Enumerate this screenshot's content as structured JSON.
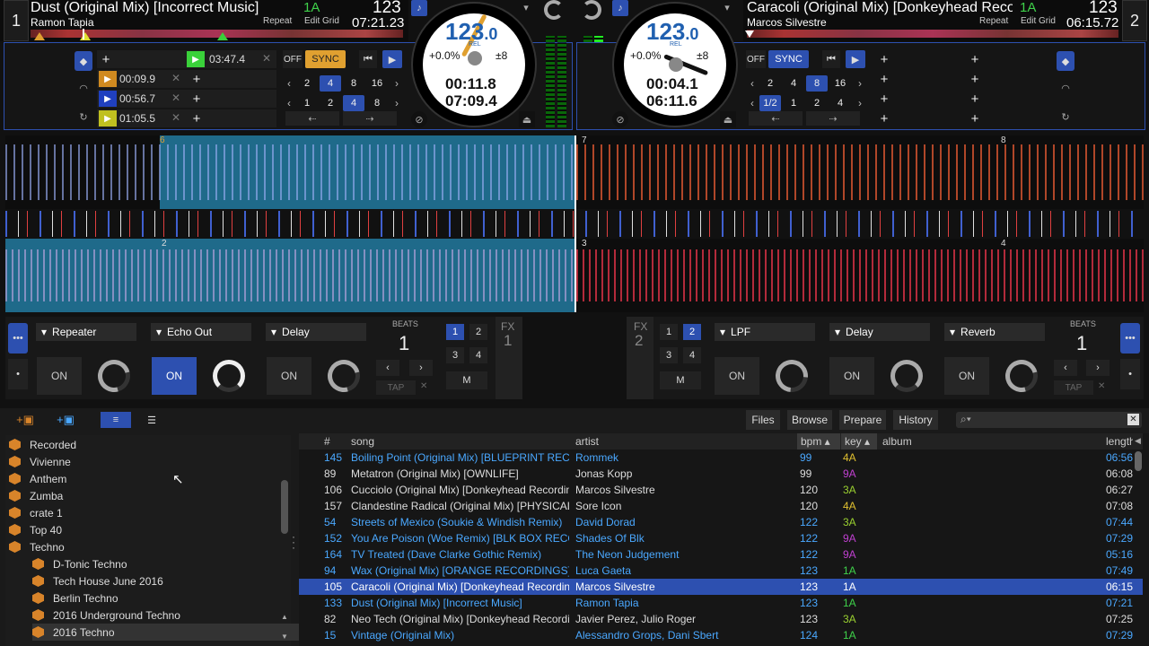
{
  "deck1": {
    "number": "1",
    "title": "Dust (Original Mix) [Incorrect Music]",
    "artist": "Ramon Tapia",
    "key": "1A",
    "bpm": "123",
    "repeat": "Repeat",
    "edit_grid": "Edit Grid",
    "time": "07:21.23",
    "loop_time": "03:47.4",
    "cues": [
      "00:09.9",
      "00:56.7",
      "01:05.5"
    ],
    "sync_off": "OFF",
    "sync": "SYNC",
    "loop_row1": [
      "2",
      "4",
      "8",
      "16"
    ],
    "loop_row2": [
      "1",
      "2",
      "4",
      "8"
    ],
    "loop_row1_selected": "4",
    "loop_row2_selected": "4",
    "jog_bpm": "123",
    "jog_bpm_dec": ".0",
    "jog_rel": "REL",
    "pitch": "+0.0%",
    "range": "±8",
    "elapsed": "00:11.8",
    "remain": "07:09.4"
  },
  "deck2": {
    "number": "2",
    "title": "Caracoli (Original Mix) [Donkeyhead Recordings]",
    "artist": "Marcos Silvestre",
    "key": "1A",
    "bpm": "123",
    "repeat": "Repeat",
    "edit_grid": "Edit Grid",
    "time": "06:15.72",
    "sync_off": "OFF",
    "sync": "SYNC",
    "loop_row1": [
      "2",
      "4",
      "8",
      "16"
    ],
    "loop_row2": [
      "1/2",
      "1",
      "2",
      "4"
    ],
    "loop_row1_selected": "8",
    "loop_row2_selected": "1/2",
    "jog_bpm": "123",
    "jog_bpm_dec": ".0",
    "jog_rel": "REL",
    "pitch": "+0.0%",
    "range": "±8",
    "elapsed": "00:04.1",
    "remain": "06:11.6"
  },
  "waveform_markers": {
    "top_left": "6",
    "top_right_a": "7",
    "top_right_b": "8",
    "bottom_left": "2",
    "bottom_right_a": "3",
    "bottom_right_b": "4"
  },
  "fx1": {
    "label": "FX",
    "num": "1",
    "effects": [
      "Repeater",
      "Echo Out",
      "Delay"
    ],
    "on_label": "ON",
    "beats_label": "BEATS",
    "beats": "1",
    "tap": "TAP",
    "slots": [
      "1",
      "2",
      "3",
      "4"
    ],
    "selected_slot": "1",
    "m": "M"
  },
  "fx2": {
    "label": "FX",
    "num": "2",
    "effects": [
      "LPF",
      "Delay",
      "Reverb"
    ],
    "on_label": "ON",
    "beats_label": "BEATS",
    "beats": "1",
    "tap": "TAP",
    "slots": [
      "1",
      "2",
      "3",
      "4"
    ],
    "selected_slot": "2",
    "m": "M"
  },
  "browser": {
    "tabs": [
      "Files",
      "Browse",
      "Prepare",
      "History"
    ],
    "search_placeholder": "",
    "tree": [
      {
        "label": "Recorded",
        "sub": false
      },
      {
        "label": "Vivienne",
        "sub": false
      },
      {
        "label": "Anthem",
        "sub": false
      },
      {
        "label": "Zumba",
        "sub": false
      },
      {
        "label": "crate 1",
        "sub": false
      },
      {
        "label": "Top 40",
        "sub": false
      },
      {
        "label": "Techno",
        "sub": false
      },
      {
        "label": "D-Tonic Techno",
        "sub": true
      },
      {
        "label": "Tech House June 2016",
        "sub": true
      },
      {
        "label": "Berlin Techno",
        "sub": true
      },
      {
        "label": "2016 Underground Techno",
        "sub": true
      },
      {
        "label": "2016 Techno",
        "sub": true
      }
    ],
    "columns": {
      "num": "#",
      "song": "song",
      "artist": "artist",
      "bpm": "bpm",
      "key": "key",
      "album": "album",
      "length": "length"
    },
    "rows": [
      {
        "num": "145",
        "song": "Boiling Point (Original Mix) [BLUEPRINT RECORDS]",
        "artist": "Rommek",
        "bpm": "99",
        "key": "4A",
        "length": "06:56",
        "hl": true,
        "kc": "#e0c030"
      },
      {
        "num": "89",
        "song": "Metatron (Original Mix) [OWNLIFE]",
        "artist": "Jonas Kopp",
        "bpm": "99",
        "key": "9A",
        "length": "06:08",
        "hl": false,
        "kc": "#c040d0"
      },
      {
        "num": "106",
        "song": "Cucciolo (Original Mix) [Donkeyhead Recordings]",
        "artist": "Marcos Silvestre",
        "bpm": "120",
        "key": "3A",
        "length": "06:27",
        "hl": false,
        "kc": "#9ad030"
      },
      {
        "num": "157",
        "song": "Clandestine Radical (Original Mix) [PHYSICAL]",
        "artist": "Sore Icon",
        "bpm": "120",
        "key": "4A",
        "length": "07:08",
        "hl": false,
        "kc": "#e0c030"
      },
      {
        "num": "54",
        "song": "Streets of Mexico (Soukie & Windish Remix)",
        "artist": "David Dorad",
        "bpm": "122",
        "key": "3A",
        "length": "07:44",
        "hl": true,
        "kc": "#9ad030"
      },
      {
        "num": "152",
        "song": "You Are Poison (Woe Remix) [BLK BOX RECORDS]",
        "artist": "Shades Of Blk",
        "bpm": "122",
        "key": "9A",
        "length": "07:29",
        "hl": true,
        "kc": "#c040d0"
      },
      {
        "num": "164",
        "song": "TV Treated (Dave Clarke Gothic Remix)",
        "artist": "The Neon Judgement",
        "bpm": "122",
        "key": "9A",
        "length": "05:16",
        "hl": true,
        "kc": "#c040d0"
      },
      {
        "num": "94",
        "song": "Wax (Original Mix) [ORANGE RECORDINGS]",
        "artist": "Luca Gaeta",
        "bpm": "123",
        "key": "1A",
        "length": "07:49",
        "hl": true,
        "kc": "#3fd14a"
      },
      {
        "num": "105",
        "song": "Caracoli (Original Mix) [Donkeyhead Recordings]",
        "artist": "Marcos Silvestre",
        "bpm": "123",
        "key": "1A",
        "length": "06:15",
        "hl": false,
        "kc": "#3fd14a",
        "sel": true
      },
      {
        "num": "133",
        "song": "Dust (Original Mix) [Incorrect Music]",
        "artist": "Ramon Tapia",
        "bpm": "123",
        "key": "1A",
        "length": "07:21",
        "hl": true,
        "kc": "#3fd14a"
      },
      {
        "num": "82",
        "song": "Neo Tech (Original Mix) [Donkeyhead Recordings]",
        "artist": "Javier Perez, Julio Roger",
        "bpm": "123",
        "key": "3A",
        "length": "07:25",
        "hl": false,
        "kc": "#9ad030"
      },
      {
        "num": "15",
        "song": "Vintage (Original Mix)",
        "artist": "Alessandro Grops, Dani Sbert",
        "bpm": "124",
        "key": "1A",
        "length": "07:29",
        "hl": true,
        "kc": "#3fd14a"
      }
    ]
  },
  "colors": {
    "accent": "#2d50b0",
    "highlight_text": "#4aa8ff",
    "key_green": "#3fd14a",
    "loop_green": "#3ad13a",
    "sync_orange": "#e0a030"
  }
}
